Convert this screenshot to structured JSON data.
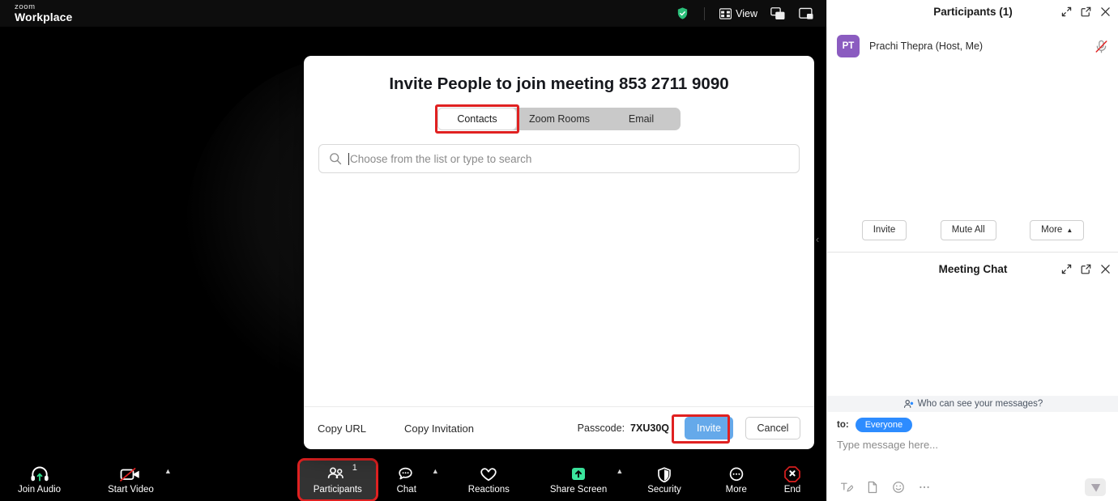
{
  "app": {
    "brand_top": "zoom",
    "brand_bottom": "Workplace"
  },
  "titlebar": {
    "security_icon": "shield-check-icon",
    "view_label": "View",
    "view_icon": "grid-icon",
    "window_icon_1": "gallery-view-icon",
    "window_icon_2": "speaker-view-icon"
  },
  "video": {
    "collapse_handle": "‹"
  },
  "modal": {
    "title": "Invite People to join meeting 853 2711 9090",
    "tabs": [
      {
        "label": "Contacts",
        "selected": true,
        "highlighted": true
      },
      {
        "label": "Zoom Rooms",
        "selected": false,
        "highlighted": false
      },
      {
        "label": "Email",
        "selected": false,
        "highlighted": false
      }
    ],
    "search": {
      "icon": "search-icon",
      "placeholder": "Choose from the list or type to search",
      "value": ""
    },
    "footer": {
      "copy_url_label": "Copy URL",
      "copy_invitation_label": "Copy Invitation",
      "passcode_label": "Passcode:",
      "passcode_value": "7XU30Q",
      "invite_label": "Invite",
      "cancel_label": "Cancel",
      "invite_highlighted": true
    }
  },
  "participants_panel": {
    "title": "Participants (1)",
    "icons": [
      "minimize-icon",
      "popout-icon",
      "close-icon"
    ],
    "rows": [
      {
        "initials": "PT",
        "name": "Prachi Thepra (Host, Me)",
        "mic_icon": "mic-muted-icon"
      }
    ],
    "actions": [
      {
        "label": "Invite",
        "caret": false
      },
      {
        "label": "Mute All",
        "caret": false
      },
      {
        "label": "More",
        "caret": true
      }
    ]
  },
  "chat_panel": {
    "title": "Meeting Chat",
    "icons": [
      "minimize-icon",
      "popout-icon",
      "close-icon"
    ],
    "who_can_see": "Who can see your messages?",
    "who_can_see_icon": "people-icon",
    "to_label": "to:",
    "to_value": "Everyone",
    "input_placeholder": "Type message here...",
    "toolbar_icons": [
      "format-text-icon",
      "file-icon",
      "emoji-icon",
      "more-dots-icon"
    ],
    "send_icon": "send-icon"
  },
  "bottom_toolbar": {
    "items": [
      {
        "label": "Join Audio",
        "icon": "headset-icon",
        "caret": false,
        "badge": "",
        "active": false,
        "highlighted": false
      },
      {
        "label": "Start Video",
        "icon": "video-off-icon",
        "caret": true,
        "badge": "",
        "active": false,
        "highlighted": false
      },
      {
        "label": "Participants",
        "icon": "participants-icon",
        "caret": false,
        "badge": "1",
        "active": true,
        "highlighted": true
      },
      {
        "label": "Chat",
        "icon": "chat-icon",
        "caret": true,
        "badge": "",
        "active": false,
        "highlighted": false
      },
      {
        "label": "Reactions",
        "icon": "reactions-icon",
        "caret": false,
        "badge": "",
        "active": false,
        "highlighted": false
      },
      {
        "label": "Share Screen",
        "icon": "share-screen-icon",
        "caret": true,
        "badge": "",
        "active": false,
        "highlighted": false
      },
      {
        "label": "Security",
        "icon": "security-icon",
        "caret": false,
        "badge": "",
        "active": false,
        "highlighted": false
      },
      {
        "label": "More",
        "icon": "more-icon",
        "caret": false,
        "badge": "",
        "active": false,
        "highlighted": false
      },
      {
        "label": "End",
        "icon": "end-call-icon",
        "caret": false,
        "badge": "",
        "active": false,
        "highlighted": false
      }
    ]
  },
  "colors": {
    "accent_blue": "#2d8cff",
    "invite_blue": "#65a9ea",
    "highlight_red": "#e02121",
    "share_green": "#3ce89f",
    "avatar_purple": "#8b5cc0",
    "end_red": "#e02121"
  }
}
